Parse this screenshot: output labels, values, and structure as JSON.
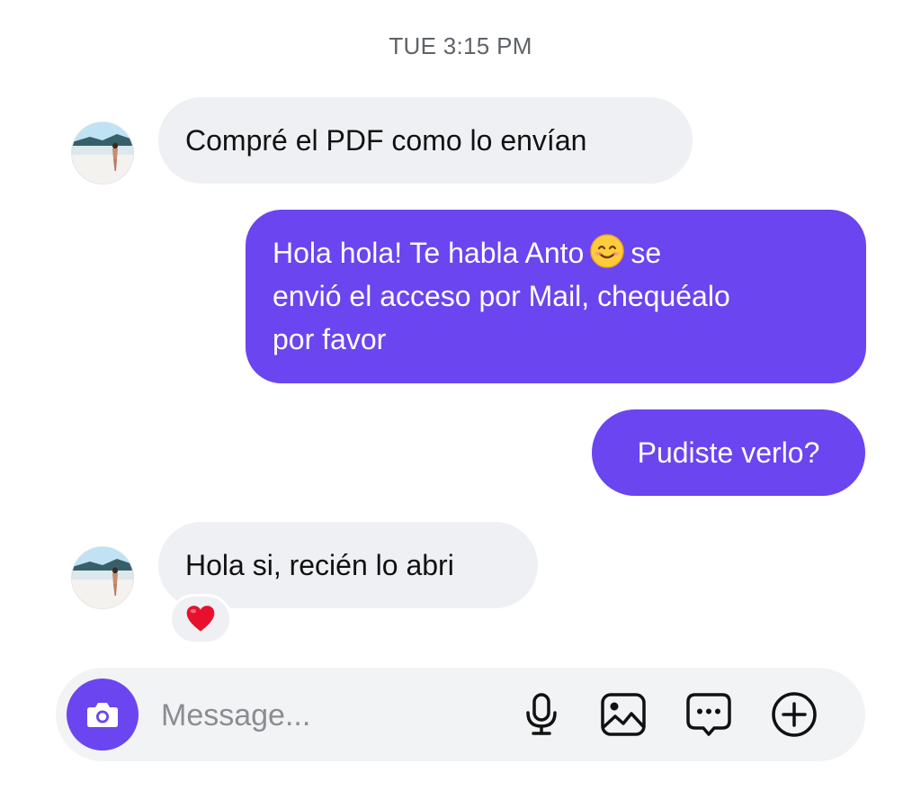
{
  "thread": {
    "timestamp": "TUE 3:15 PM"
  },
  "messages": [
    {
      "direction": "incoming",
      "text": "Compré el PDF como lo envían"
    },
    {
      "direction": "outgoing",
      "text_before_emoji": "Hola hola! Te habla Anto",
      "emoji": "smiling-face-icon",
      "text_after_emoji": "se",
      "line2": "envió el acceso por Mail, chequéalo",
      "line3": "por favor"
    },
    {
      "direction": "outgoing",
      "text": "Pudiste verlo?"
    },
    {
      "direction": "incoming",
      "text": "Hola si, recién lo abri",
      "reaction": "red-heart-icon"
    }
  ],
  "composer": {
    "placeholder": "Message...",
    "icons": [
      "camera-icon",
      "microphone-icon",
      "gallery-icon",
      "sticker-chat-icon",
      "plus-circle-icon"
    ]
  },
  "colors": {
    "accent": "#6a45f0",
    "incoming_bubble": "#eff0f3",
    "composer_bg": "#f2f3f5",
    "timestamp": "#5f6368"
  }
}
